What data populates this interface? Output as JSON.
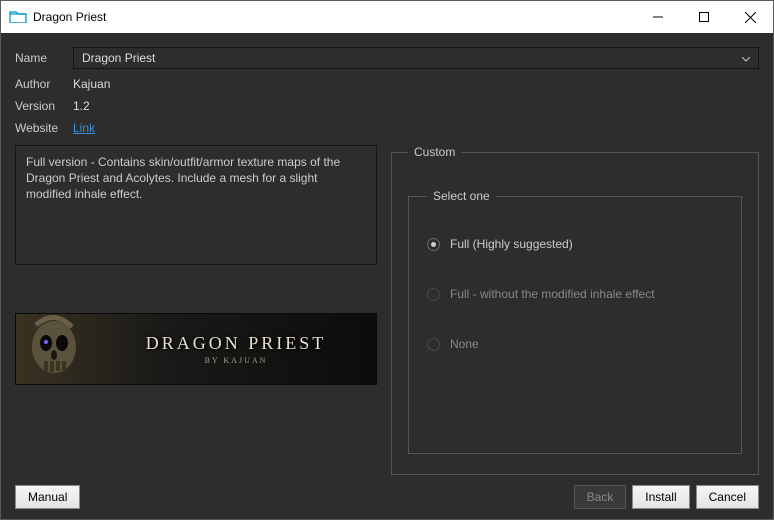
{
  "window": {
    "title": "Dragon Priest"
  },
  "fields": {
    "name_label": "Name",
    "name_value": "Dragon Priest",
    "author_label": "Author",
    "author_value": "Kajuan",
    "version_label": "Version",
    "version_value": "1.2",
    "website_label": "Website",
    "website_link": "Link"
  },
  "description": "Full version - Contains skin/outfit/armor texture maps of the Dragon Priest and Acolytes. Include a mesh for a slight modified inhale effect.",
  "banner": {
    "title": "DRAGON PRIEST",
    "subtitle": "BY KAJUAN"
  },
  "custom": {
    "legend": "Custom",
    "group_legend": "Select one",
    "options": [
      {
        "label": "Full (Highly suggested)",
        "selected": true
      },
      {
        "label": "Full - without the modified inhale effect",
        "selected": false
      },
      {
        "label": "None",
        "selected": false
      }
    ]
  },
  "buttons": {
    "manual": "Manual",
    "back": "Back",
    "install": "Install",
    "cancel": "Cancel"
  }
}
